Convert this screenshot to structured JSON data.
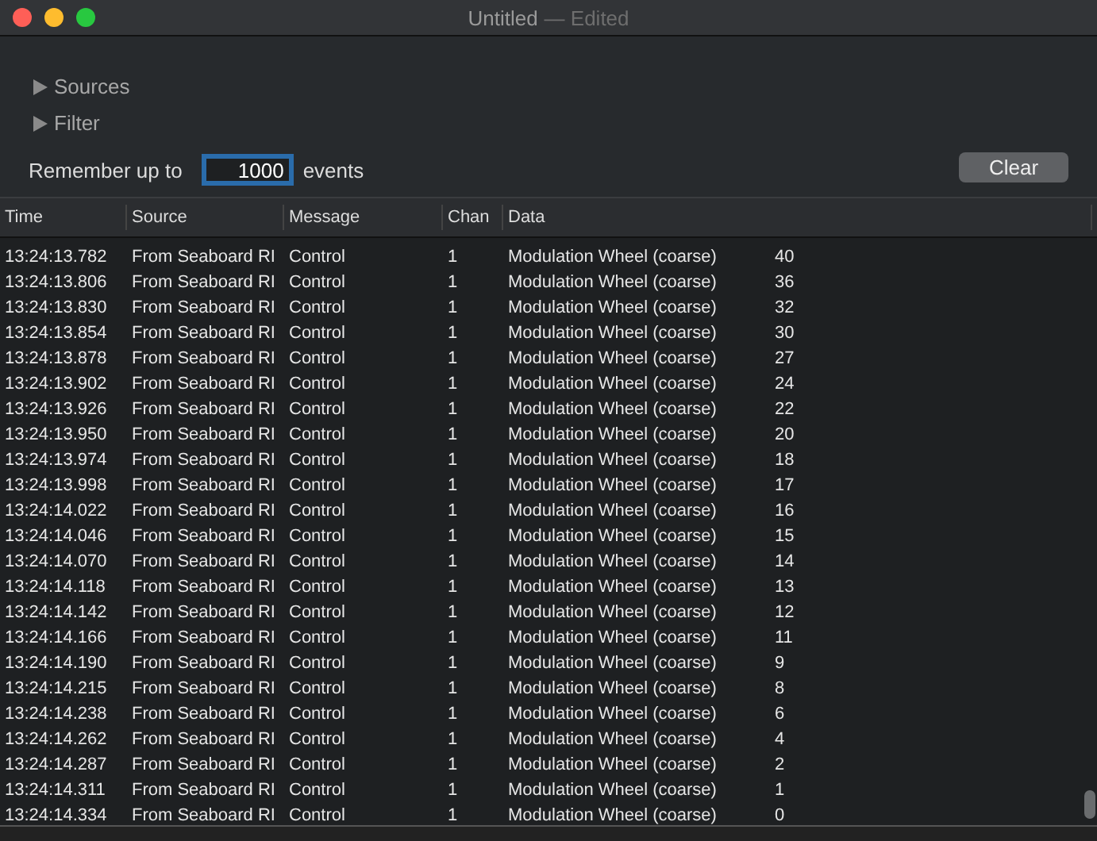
{
  "window": {
    "title": "Untitled",
    "subtitle": "— Edited"
  },
  "disclosures": [
    {
      "label": "Sources",
      "expanded": false
    },
    {
      "label": "Filter",
      "expanded": false
    }
  ],
  "remember": {
    "label": "Remember up to",
    "value": "1000",
    "suffix": "events"
  },
  "clear_button": "Clear",
  "table": {
    "columns": [
      "Time",
      "Source",
      "Message",
      "Chan",
      "Data"
    ],
    "rows": [
      {
        "time": "13:24:13.782",
        "source": "From Seaboard RI",
        "message": "Control",
        "chan": "1",
        "data": "Modulation Wheel (coarse)",
        "value": "40"
      },
      {
        "time": "13:24:13.806",
        "source": "From Seaboard RI",
        "message": "Control",
        "chan": "1",
        "data": "Modulation Wheel (coarse)",
        "value": "36"
      },
      {
        "time": "13:24:13.830",
        "source": "From Seaboard RI",
        "message": "Control",
        "chan": "1",
        "data": "Modulation Wheel (coarse)",
        "value": "32"
      },
      {
        "time": "13:24:13.854",
        "source": "From Seaboard RI",
        "message": "Control",
        "chan": "1",
        "data": "Modulation Wheel (coarse)",
        "value": "30"
      },
      {
        "time": "13:24:13.878",
        "source": "From Seaboard RI",
        "message": "Control",
        "chan": "1",
        "data": "Modulation Wheel (coarse)",
        "value": "27"
      },
      {
        "time": "13:24:13.902",
        "source": "From Seaboard RI",
        "message": "Control",
        "chan": "1",
        "data": "Modulation Wheel (coarse)",
        "value": "24"
      },
      {
        "time": "13:24:13.926",
        "source": "From Seaboard RI",
        "message": "Control",
        "chan": "1",
        "data": "Modulation Wheel (coarse)",
        "value": "22"
      },
      {
        "time": "13:24:13.950",
        "source": "From Seaboard RI",
        "message": "Control",
        "chan": "1",
        "data": "Modulation Wheel (coarse)",
        "value": "20"
      },
      {
        "time": "13:24:13.974",
        "source": "From Seaboard RI",
        "message": "Control",
        "chan": "1",
        "data": "Modulation Wheel (coarse)",
        "value": "18"
      },
      {
        "time": "13:24:13.998",
        "source": "From Seaboard RI",
        "message": "Control",
        "chan": "1",
        "data": "Modulation Wheel (coarse)",
        "value": "17"
      },
      {
        "time": "13:24:14.022",
        "source": "From Seaboard RI",
        "message": "Control",
        "chan": "1",
        "data": "Modulation Wheel (coarse)",
        "value": "16"
      },
      {
        "time": "13:24:14.046",
        "source": "From Seaboard RI",
        "message": "Control",
        "chan": "1",
        "data": "Modulation Wheel (coarse)",
        "value": "15"
      },
      {
        "time": "13:24:14.070",
        "source": "From Seaboard RI",
        "message": "Control",
        "chan": "1",
        "data": "Modulation Wheel (coarse)",
        "value": "14"
      },
      {
        "time": "13:24:14.118",
        "source": "From Seaboard RI",
        "message": "Control",
        "chan": "1",
        "data": "Modulation Wheel (coarse)",
        "value": "13"
      },
      {
        "time": "13:24:14.142",
        "source": "From Seaboard RI",
        "message": "Control",
        "chan": "1",
        "data": "Modulation Wheel (coarse)",
        "value": "12"
      },
      {
        "time": "13:24:14.166",
        "source": "From Seaboard RI",
        "message": "Control",
        "chan": "1",
        "data": "Modulation Wheel (coarse)",
        "value": "11"
      },
      {
        "time": "13:24:14.190",
        "source": "From Seaboard RI",
        "message": "Control",
        "chan": "1",
        "data": "Modulation Wheel (coarse)",
        "value": "9"
      },
      {
        "time": "13:24:14.215",
        "source": "From Seaboard RI",
        "message": "Control",
        "chan": "1",
        "data": "Modulation Wheel (coarse)",
        "value": "8"
      },
      {
        "time": "13:24:14.238",
        "source": "From Seaboard RI",
        "message": "Control",
        "chan": "1",
        "data": "Modulation Wheel (coarse)",
        "value": "6"
      },
      {
        "time": "13:24:14.262",
        "source": "From Seaboard RI",
        "message": "Control",
        "chan": "1",
        "data": "Modulation Wheel (coarse)",
        "value": "4"
      },
      {
        "time": "13:24:14.287",
        "source": "From Seaboard RI",
        "message": "Control",
        "chan": "1",
        "data": "Modulation Wheel (coarse)",
        "value": "2"
      },
      {
        "time": "13:24:14.311",
        "source": "From Seaboard RI",
        "message": "Control",
        "chan": "1",
        "data": "Modulation Wheel (coarse)",
        "value": "1"
      },
      {
        "time": "13:24:14.334",
        "source": "From Seaboard RI",
        "message": "Control",
        "chan": "1",
        "data": "Modulation Wheel (coarse)",
        "value": "0"
      }
    ]
  }
}
